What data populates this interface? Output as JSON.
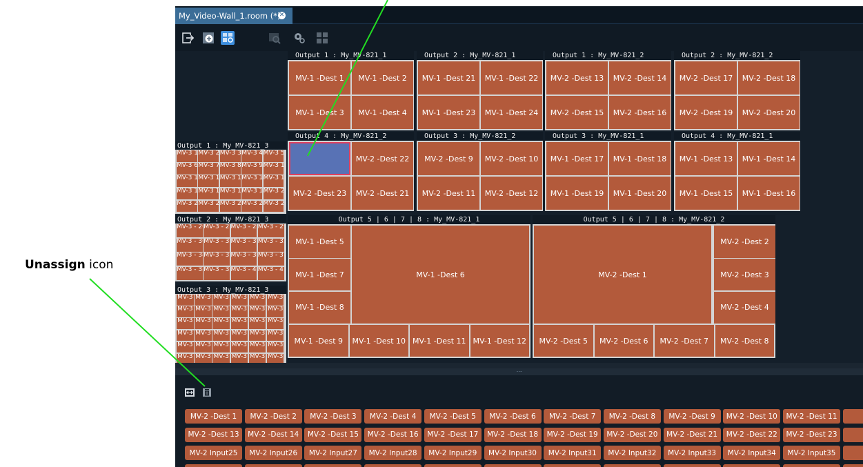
{
  "annotation": {
    "bold": "Unassign",
    "rest": " icon"
  },
  "tab": {
    "title": "My_Video-Wall_1.room (*)",
    "close": "✕"
  },
  "toolbar": {
    "buttons": [
      {
        "name": "exit-icon"
      },
      {
        "name": "add-icon"
      },
      {
        "name": "link-mode-icon"
      },
      {
        "name": "zoom-icon"
      },
      {
        "name": "link-settings-icon"
      },
      {
        "name": "grid-icon"
      }
    ]
  },
  "groups": [
    {
      "title": "Output 1 : My_MV-821_1",
      "tiles": [
        "MV-1 -Dest 1",
        "MV-1 -Dest 2",
        "MV-1 -Dest 3",
        "MV-1 -Dest 4"
      ]
    },
    {
      "title": "Output 2 : My_MV-821_1",
      "tiles": [
        "MV-1 -Dest 21",
        "MV-1 -Dest 22",
        "MV-1 -Dest 23",
        "MV-1 -Dest 24"
      ]
    },
    {
      "title": "Output 1 : My_MV-821_2",
      "tiles": [
        "MV-2 -Dest 13",
        "MV-2 -Dest 14",
        "MV-2 -Dest 15",
        "MV-2 -Dest 16"
      ]
    },
    {
      "title": "Output 2 : My_MV-821_2",
      "tiles": [
        "MV-2 -Dest 17",
        "MV-2 -Dest 18",
        "MV-2 -Dest 19",
        "MV-2 -Dest 20"
      ]
    },
    {
      "title": "Output 4 : My_MV-821_2",
      "tiles": [
        "",
        "MV-2 -Dest 22",
        "MV-2 -Dest 23",
        "MV-2 -Dest 21"
      ]
    },
    {
      "title": "Output 3 : My_MV-821_2",
      "tiles": [
        "MV-2 -Dest 9",
        "MV-2 -Dest 10",
        "MV-2 -Dest 11",
        "MV-2 -Dest 12"
      ]
    },
    {
      "title": "Output 3 : My_MV-821_1",
      "tiles": [
        "MV-1 -Dest 17",
        "MV-1 -Dest 18",
        "MV-1 -Dest 19",
        "MV-1 -Dest 20"
      ]
    },
    {
      "title": "Output 4 : My_MV-821_1",
      "tiles": [
        "MV-1 -Dest 13",
        "MV-1 -Dest 14",
        "MV-1 -Dest 15",
        "MV-1 -Dest 16"
      ]
    }
  ],
  "big_groups": [
    {
      "title": "Output 5 | 6 | 7 | 8 : My_MV-821_1",
      "main": "MV-1 -Dest 6",
      "side": [
        "MV-1 -Dest 5",
        "MV-1 -Dest 7",
        "MV-1 -Dest 8"
      ],
      "bottom": [
        "MV-1 -Dest 9",
        "MV-1 -Dest 10",
        "MV-1 -Dest 11",
        "MV-1 -Dest 12"
      ]
    },
    {
      "title": "Output 5 | 6 | 7 | 8 : My_MV-821_2",
      "main": "MV-2 -Dest 1",
      "side": [
        "MV-2 -Dest 2",
        "MV-2 -Dest 3",
        "MV-2 -Dest 4"
      ],
      "bottom": [
        "MV-2 -Dest 5",
        "MV-2 -Dest 6",
        "MV-2 -Dest 7",
        "MV-2 -Dest 8"
      ]
    }
  ],
  "mini_groups": [
    {
      "title": "Output 1 : My_MV-821_3",
      "cols": 5,
      "rows": 5,
      "prefix": "MV-3",
      "start": 1
    },
    {
      "title": "Output 2 : My_MV-821_3",
      "cols": 4,
      "rows": 4,
      "prefix": "MV-3 -",
      "start": 26
    },
    {
      "title": "Output 3 : My_MV-821_3",
      "cols": 6,
      "rows": 6,
      "prefix": "MV-3",
      "start": 0
    }
  ],
  "lower_panel": {
    "buttons": [
      {
        "name": "fit-width-icon"
      },
      {
        "name": "unassign-icon"
      }
    ],
    "rows": [
      [
        "MV-2 -Dest 1",
        "MV-2 -Dest 2",
        "MV-2 -Dest 3",
        "MV-2 -Dest 4",
        "MV-2 -Dest 5",
        "MV-2 -Dest 6",
        "MV-2 -Dest 7",
        "MV-2 -Dest 8",
        "MV-2 -Dest 9",
        "MV-2 -Dest 10",
        "MV-2 -Dest 11",
        "MV-"
      ],
      [
        "MV-2 -Dest 13",
        "MV-2 -Dest 14",
        "MV-2 -Dest 15",
        "MV-2 -Dest 16",
        "MV-2 -Dest 17",
        "MV-2 -Dest 18",
        "MV-2 -Dest 19",
        "MV-2 -Dest 20",
        "MV-2 -Dest 21",
        "MV-2 -Dest 22",
        "MV-2 -Dest 23",
        "MV-"
      ],
      [
        "MV-2 Input25",
        "MV-2 Input26",
        "MV-2 Input27",
        "MV-2 Input28",
        "MV-2 Input29",
        "MV-2 Input30",
        "MV-2 Input31",
        "MV-2 Input32",
        "MV-2 Input33",
        "MV-2 Input34",
        "MV-2 Input35",
        "MV-"
      ],
      [
        "",
        "",
        "",
        "",
        "",
        "",
        "",
        "",
        "",
        "",
        "",
        ""
      ]
    ]
  },
  "splitter": "⋯"
}
